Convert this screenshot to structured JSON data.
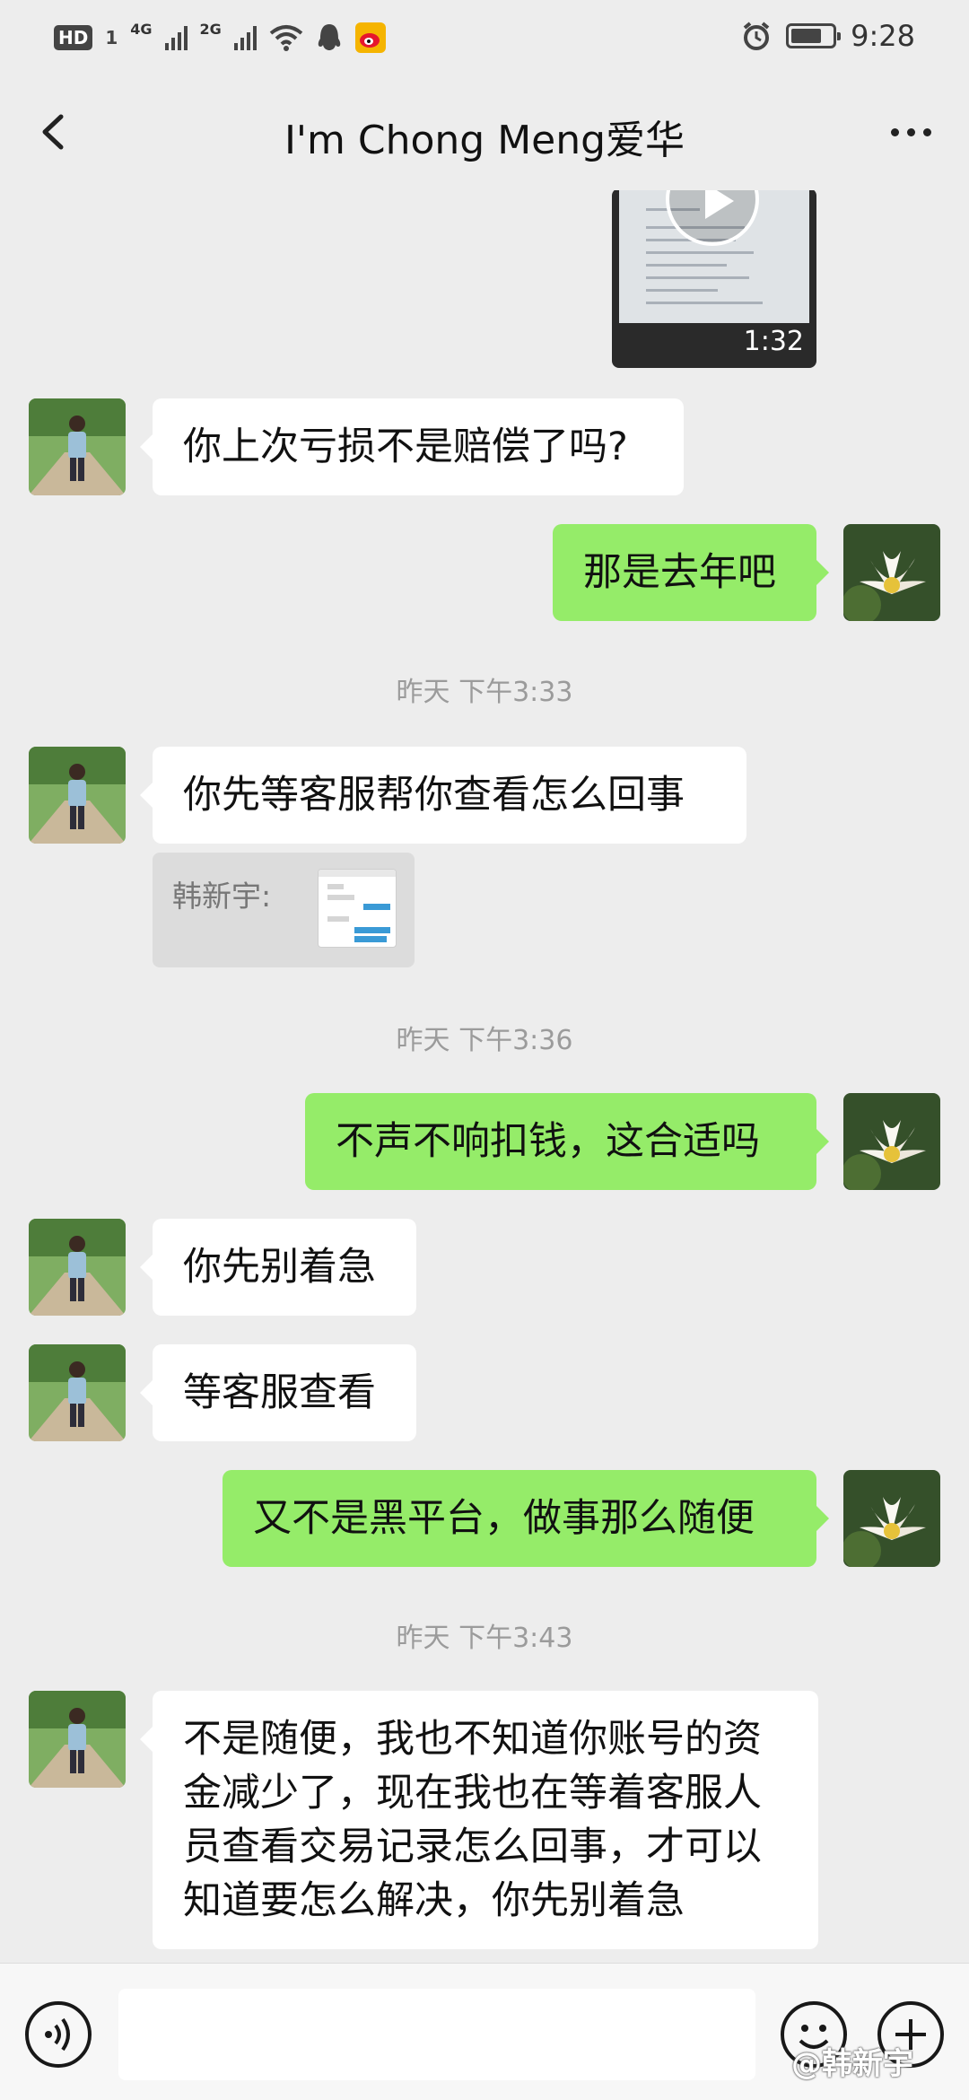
{
  "status_bar": {
    "hd_badge": "HD",
    "sim1": "1",
    "net1": "4G",
    "net2": "2G",
    "time": "9:28",
    "battery_level": 0.75
  },
  "header": {
    "title": "I'm Chong Meng爱华"
  },
  "video": {
    "duration": "1:32"
  },
  "messages": [
    {
      "side": "left",
      "text": "你上次亏损不是赔偿了吗?"
    },
    {
      "side": "right",
      "text": "那是去年吧"
    },
    {
      "side": "left",
      "text": "你先等客服帮你查看怎么回事"
    },
    {
      "side": "right",
      "text": "不声不响扣钱，这合适吗"
    },
    {
      "side": "left",
      "text": "你先别着急"
    },
    {
      "side": "left",
      "text": "等客服查看"
    },
    {
      "side": "right",
      "text": "又不是黑平台，做事那么随便"
    },
    {
      "side": "left",
      "text": "不是随便，我也不知道你账号的资金减少了，现在我也在等着客服人员查看交易记录怎么回事，才可以知道要怎么解决，你先别着急"
    }
  ],
  "quote": {
    "label": "韩新宇:"
  },
  "timestamps": [
    "昨天 下午3:33",
    "昨天 下午3:36",
    "昨天 下午3:43"
  ],
  "watermark": "@韩新宇",
  "colors": {
    "background": "#ededed",
    "incoming_bubble": "#ffffff",
    "outgoing_bubble": "#95ec69"
  }
}
